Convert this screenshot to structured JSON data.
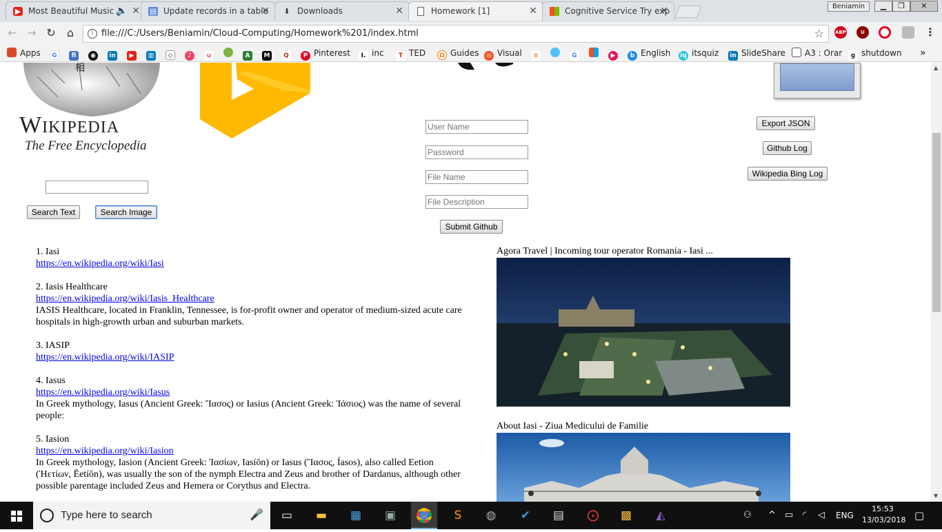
{
  "tabs": [
    {
      "label": "Most Beautiful Music",
      "icon": "youtube-icon"
    },
    {
      "label": "Update records in a table",
      "icon": "document-icon"
    },
    {
      "label": "Downloads",
      "icon": "download-icon"
    },
    {
      "label": "Homework [1]",
      "icon": "page-icon"
    },
    {
      "label": "Cognitive Service Try exp",
      "icon": "microsoft-icon"
    }
  ],
  "window": {
    "user": "Beniamin"
  },
  "address": {
    "url": "file:///C:/Users/Beniamin/Cloud-Computing/Homework%201/index.html"
  },
  "extensions": [
    "ABP",
    "U",
    "O"
  ],
  "bookmarks": {
    "apps": "Apps",
    "pinterest": "Pinterest",
    "inc": "inc",
    "ted": "TED",
    "guides": "Guides",
    "visual": "Visual",
    "english": "English",
    "itsquiz": "itsquiz",
    "slideshare": "SlideShare",
    "orar": "A3 : Orar",
    "shutdown": "shutdown",
    "more": "»"
  },
  "wiki": {
    "title": "Wikipedia",
    "subtitle": "The Free Encyclopedia"
  },
  "search": {
    "value": "",
    "text_button": "Search Text",
    "image_button": "Search Image"
  },
  "github_form": {
    "username_placeholder": "User Name",
    "password_placeholder": "Password",
    "filename_placeholder": "File Name",
    "filedesc_placeholder": "File Description",
    "submit_label": "Submit Github"
  },
  "actions": {
    "export_json": "Export JSON",
    "github_log": "Github Log",
    "wiki_bing_log": "Wikipedia Bing Log"
  },
  "results": [
    {
      "title": "1. Iasi",
      "url": "https://en.wikipedia.org/wiki/Iasi",
      "desc": ""
    },
    {
      "title": "2. Iasis Healthcare",
      "url": "https://en.wikipedia.org/wiki/Iasis_Healthcare",
      "desc": "IASIS Healthcare, located in Franklin, Tennessee, is for-profit owner and operator of medium-sized acute care hospitals in high-growth urban and suburban markets."
    },
    {
      "title": "3. IASIP",
      "url": "https://en.wikipedia.org/wiki/IASIP",
      "desc": ""
    },
    {
      "title": "4. Iasus",
      "url": "https://en.wikipedia.org/wiki/Iasus",
      "desc": "In Greek mythology, Iasus (Ancient Greek: Ἴασος) or Iasius (Ancient Greek: Ἰάσιος) was the name of several people:"
    },
    {
      "title": "5. Iasion",
      "url": "https://en.wikipedia.org/wiki/Iasion",
      "desc": "In Greek mythology, Iasion (Ancient Greek: Ἰασίων, Iasíōn) or Iasus (Ἴασος, Íasos), also called Eetion (Ἠετίων, Ēetíōn), was usually the son of the nymph Electra and Zeus and brother of Dardanus, although other possible parentage included Zeus and Hemera or Corythus and Electra."
    }
  ],
  "images": [
    {
      "caption": "Agora Travel | Incoming tour operator Romania - Iasi ..."
    },
    {
      "caption": "About Iasi - Ziua Medicului de Familie"
    }
  ],
  "taskbar": {
    "search_placeholder": "Type here to search",
    "lang": "ENG",
    "time": "15:53",
    "date": "13/03/2018"
  }
}
